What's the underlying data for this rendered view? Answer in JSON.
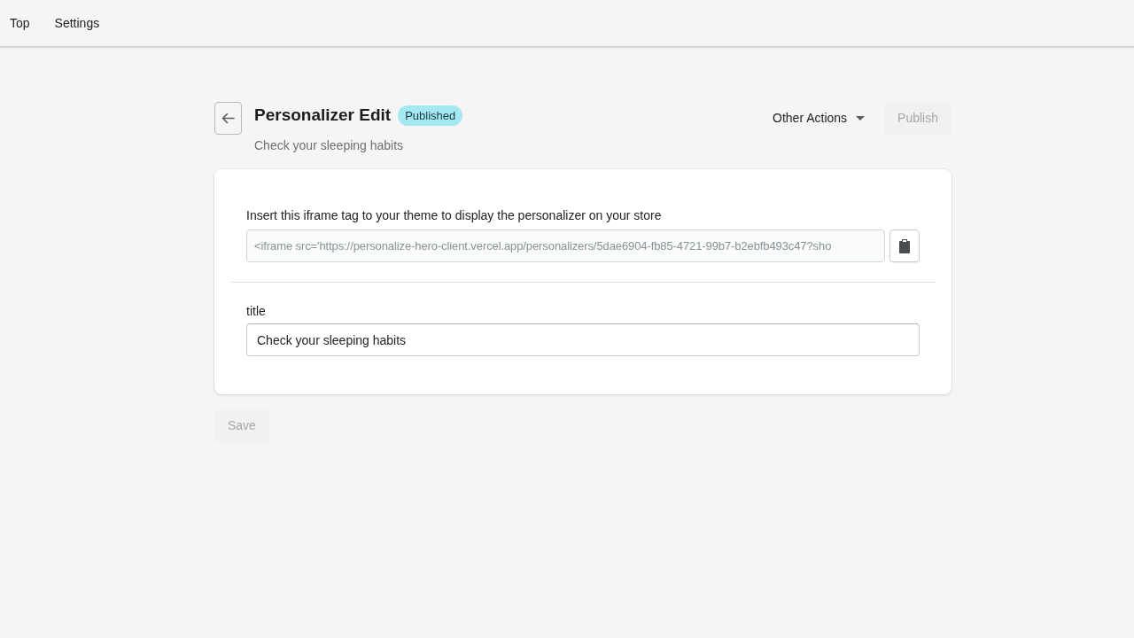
{
  "nav": {
    "items": [
      {
        "label": "Top"
      },
      {
        "label": "Settings"
      }
    ]
  },
  "header": {
    "title": "Personalizer Edit",
    "status_badge": "Published",
    "subtitle": "Check your sleeping habits",
    "other_actions": {
      "label": "Other Actions"
    },
    "publish_button": {
      "label": "Publish",
      "disabled": true
    }
  },
  "card": {
    "sections": [
      {
        "kind": "embed",
        "label": "Insert this iframe tag to your theme to display the personalizer on your store",
        "field": {
          "value": "<iframe src='https://personalize-hero-client.vercel.app/personalizers/5dae6904-fb85-4721-99b7-b2ebfb493c47?sho",
          "disabled": true
        }
      },
      {
        "kind": "text",
        "label": "title",
        "field": {
          "value": "Check your sleeping habits",
          "disabled": false
        }
      }
    ]
  },
  "save_button": {
    "label": "Save",
    "disabled": true
  }
}
